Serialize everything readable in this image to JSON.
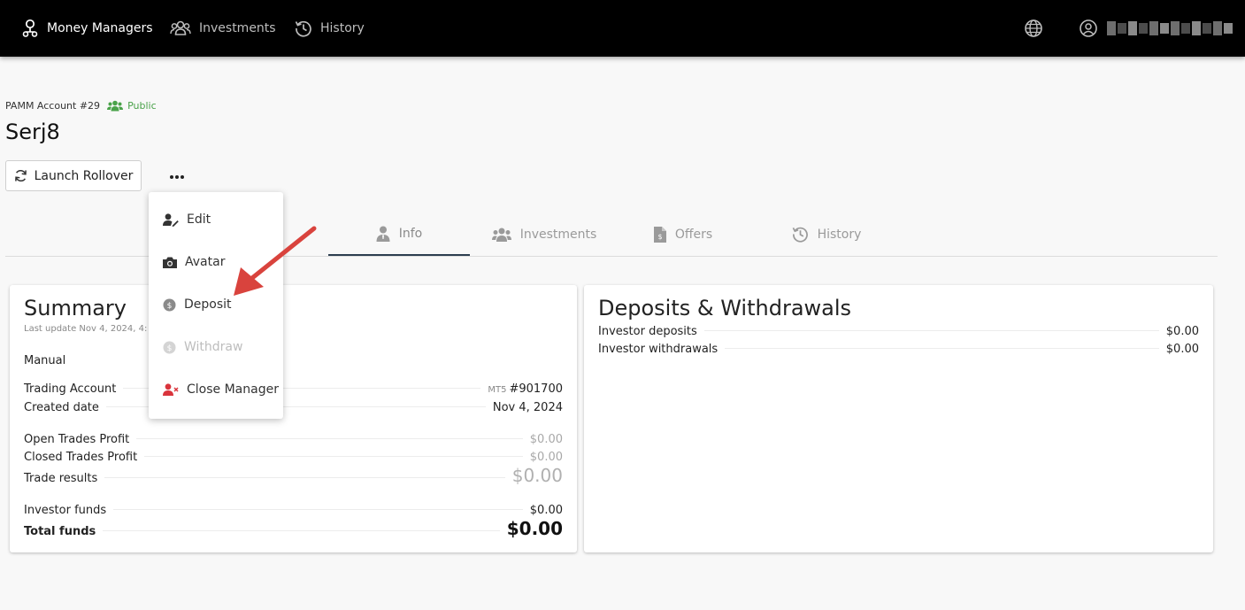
{
  "nav": {
    "money_managers": "Money Managers",
    "investments": "Investments",
    "history": "History"
  },
  "header": {
    "account_label": "PAMM Account #29",
    "visibility": "Public",
    "account_name": "Serj8",
    "launch_rollover": "Launch Rollover"
  },
  "menu": {
    "edit": "Edit",
    "avatar": "Avatar",
    "deposit": "Deposit",
    "withdraw": "Withdraw",
    "close_manager": "Close Manager"
  },
  "tabs": {
    "info": "Info",
    "investments": "Investments",
    "offers": "Offers",
    "history": "History"
  },
  "summary": {
    "title": "Summary",
    "last_update": "Last update Nov 4, 2024, 4:",
    "mode": "Manual",
    "trading_account_label": "Trading Account",
    "trading_account_platform": "MT5",
    "trading_account_value": "#901700",
    "created_date_label": "Created date",
    "created_date_value": "Nov 4, 2024",
    "open_trades_profit_label": "Open Trades Profit",
    "open_trades_profit_value": "$0.00",
    "closed_trades_profit_label": "Closed Trades Profit",
    "closed_trades_profit_value": "$0.00",
    "trade_results_label": "Trade results",
    "trade_results_value": "$0.00",
    "investor_funds_label": "Investor funds",
    "investor_funds_value": "$0.00",
    "total_funds_label": "Total funds",
    "total_funds_value": "$0.00"
  },
  "deposits_withdrawals": {
    "title": "Deposits & Withdrawals",
    "investor_deposits_label": "Investor deposits",
    "investor_deposits_value": "$0.00",
    "investor_withdrawals_label": "Investor withdrawals",
    "investor_withdrawals_value": "$0.00"
  },
  "colors": {
    "topbar": "#000000",
    "public_green": "#4aa24a",
    "active_tab_underline": "#2d3e50",
    "close_manager_icon": "#d9343c",
    "annotation_arrow": "#d9433d"
  },
  "icons": {
    "money_managers": "user-network-icon",
    "investments": "users-group-icon",
    "history": "history-icon",
    "language": "globe-icon",
    "account": "user-circle-icon",
    "rollover": "refresh-icon",
    "more": "ellipsis-icon"
  }
}
